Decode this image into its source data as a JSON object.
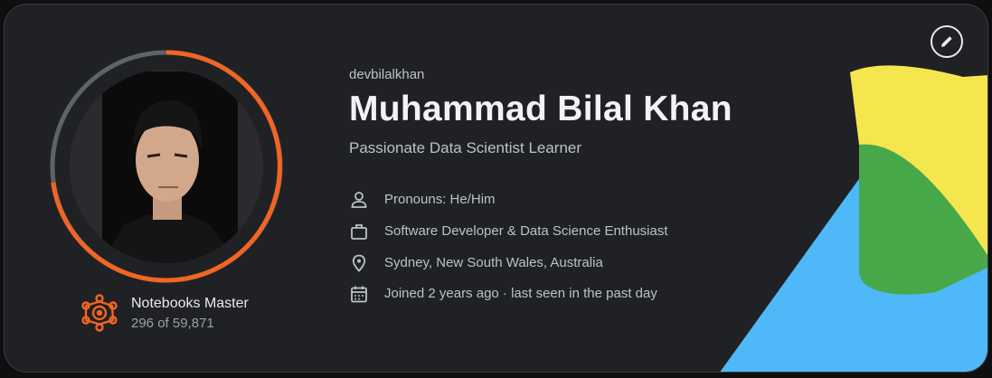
{
  "profile": {
    "username": "devbilalkhan",
    "name": "Muhammad Bilal Khan",
    "tagline": "Passionate Data Scientist Learner",
    "avatar_icon": "user-photo",
    "tier": {
      "icon": "notebooks-tier-icon",
      "title": "Notebooks Master",
      "rank": "296 of 59,871"
    },
    "details": [
      {
        "icon": "person-icon",
        "text": "Pronouns: He/Him"
      },
      {
        "icon": "briefcase-icon",
        "text": "Software Developer & Data Science Enthusiast"
      },
      {
        "icon": "location-pin-icon",
        "text": "Sydney, New South Wales, Australia"
      },
      {
        "icon": "calendar-icon",
        "text": "Joined 2 years ago · last seen in the past day"
      }
    ],
    "edit_icon": "pencil-icon"
  },
  "colors": {
    "card_bg": "#202124",
    "accent_orange": "#f26522",
    "blob_yellow": "#f5e64e",
    "blob_green": "#47a84a",
    "blob_blue": "#4fb8f8"
  }
}
